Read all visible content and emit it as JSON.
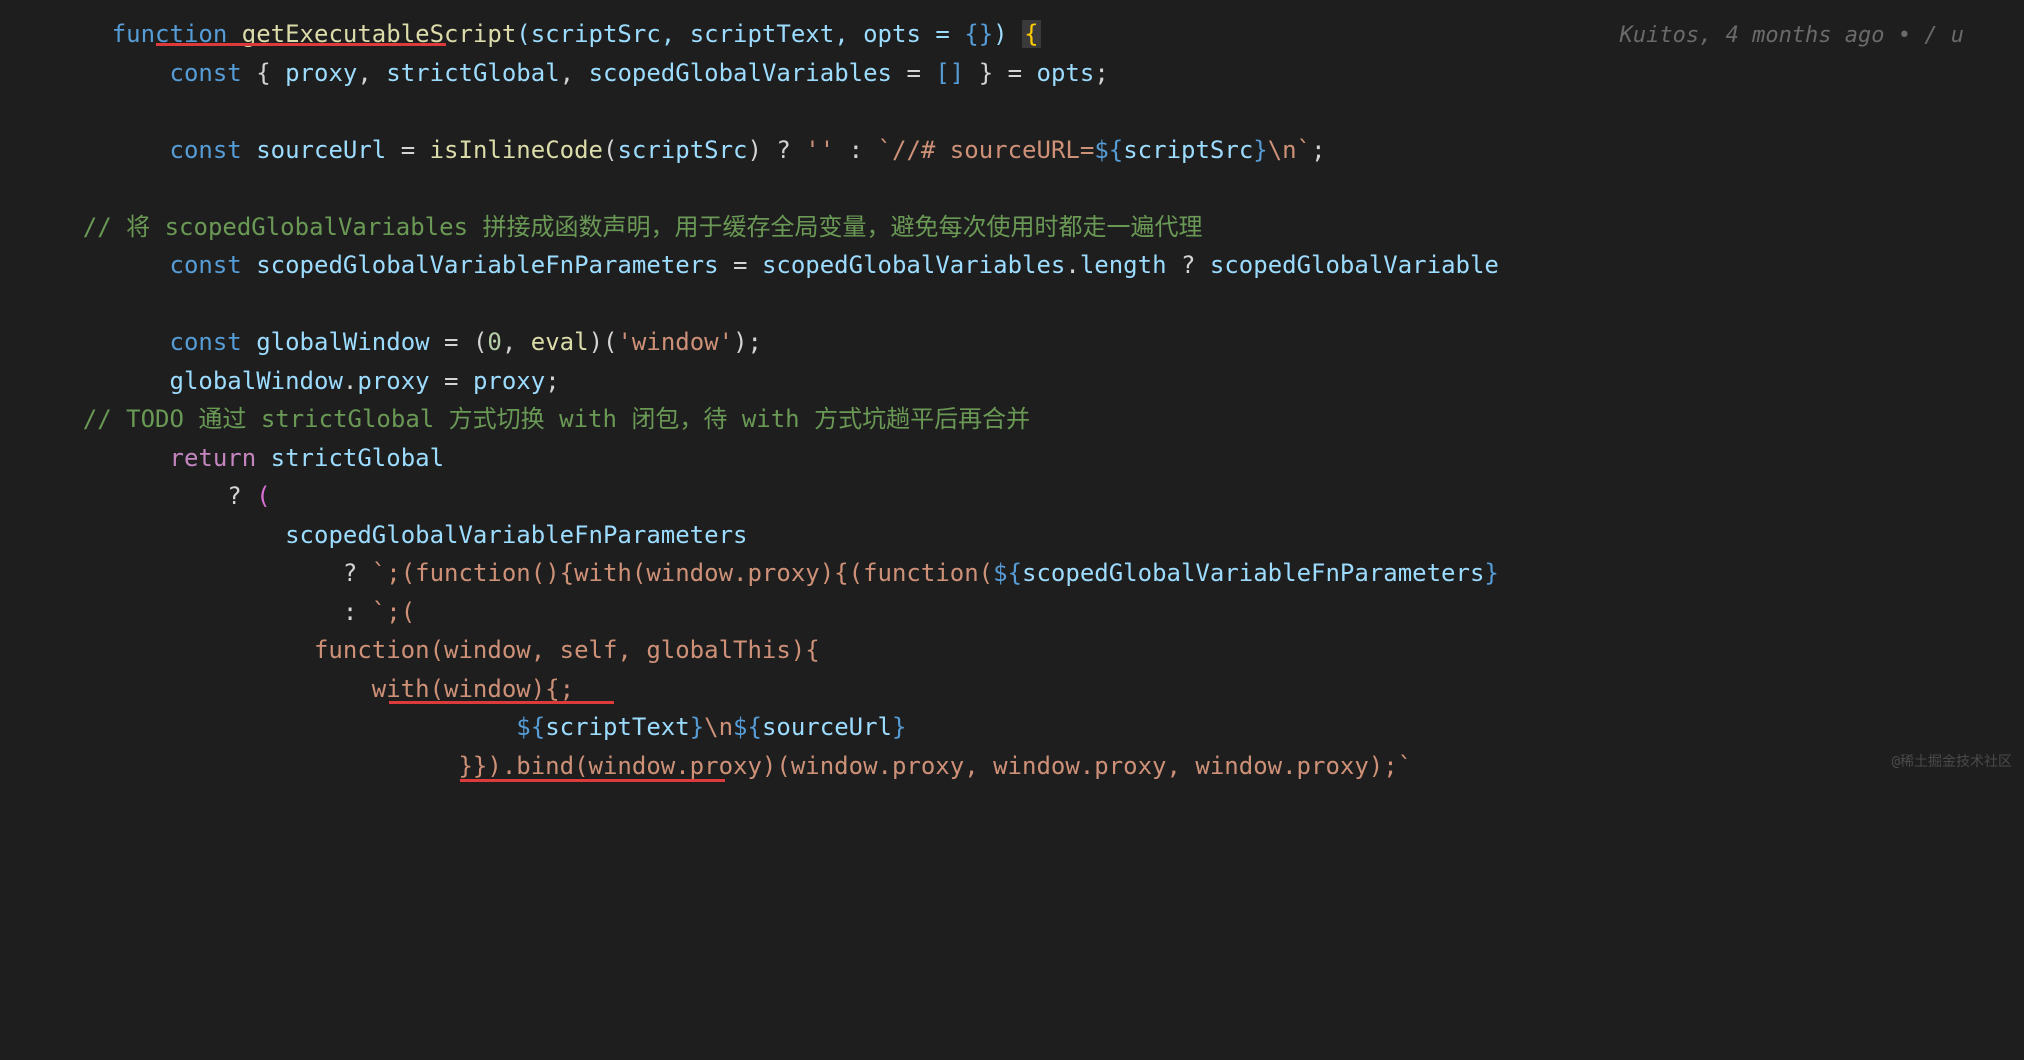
{
  "git_blame": "Kuitos, 4 months ago •  ∕ u",
  "watermark": "@稀土掘金技术社区",
  "lines": {
    "l1_function": "function",
    "l1_fnname": " getExecutableScript",
    "l1_params": "(scriptSrc, scriptText, opts = {}) ",
    "l1_brace": "{",
    "l2_const": "    const ",
    "l2_destructure": "{ proxy, strictGlobal, scopedGlobalVariables = [] } = opts;",
    "l4_const": "    const ",
    "l4_var": "sourceUrl",
    "l4_eq": " = ",
    "l4_fn": "isInlineCode",
    "l4_paren": "(scriptSrc) ? ",
    "l4_empty": "''",
    "l4_colon": " : ",
    "l4_tmpl": "`//# sourceURL=${scriptSrc}\\n`",
    "l4_semi": ";",
    "l6_comment": "    // 将 scopedGlobalVariables 拼接成函数声明，用于缓存全局变量，避免每次使用时都走一遍代理",
    "l7_const": "    const ",
    "l7_var": "scopedGlobalVariableFnParameters",
    "l7_eq": " = ",
    "l7_expr": "scopedGlobalVariables.length ? scopedGlobalVariable",
    "l9_const": "    const ",
    "l9_var": "globalWindow",
    "l9_eq": " = ",
    "l9_eval": "(0, eval)('window');",
    "l10": "    globalWindow.proxy = proxy;",
    "l11_comment": "    // TODO 通过 strictGlobal 方式切换 with 闭包，待 with 方式坑趟平后再合并",
    "l12_return": "    return ",
    "l12_var": "strictGlobal",
    "l13": "        ? (",
    "l14": "            scopedGlobalVariableFnParameters",
    "l15_q": "                ? ",
    "l15_tmpl": "`;(function(){with(window.proxy){(function(${scopedGlobalVariableFnParameters}",
    "l16_c": "                : ",
    "l16_tmpl": "`;(",
    "l17_tmpl": "                    function(window, self, globalThis){",
    "l18_tmpl": "                        with(window){;",
    "l19_pre": "                            ",
    "l19_tmpl": "${scriptText}\\n${sourceUrl}",
    "l20_tmpl": "                        }}).bind(window.proxy)(window.proxy, window.proxy, window.proxy);`"
  }
}
